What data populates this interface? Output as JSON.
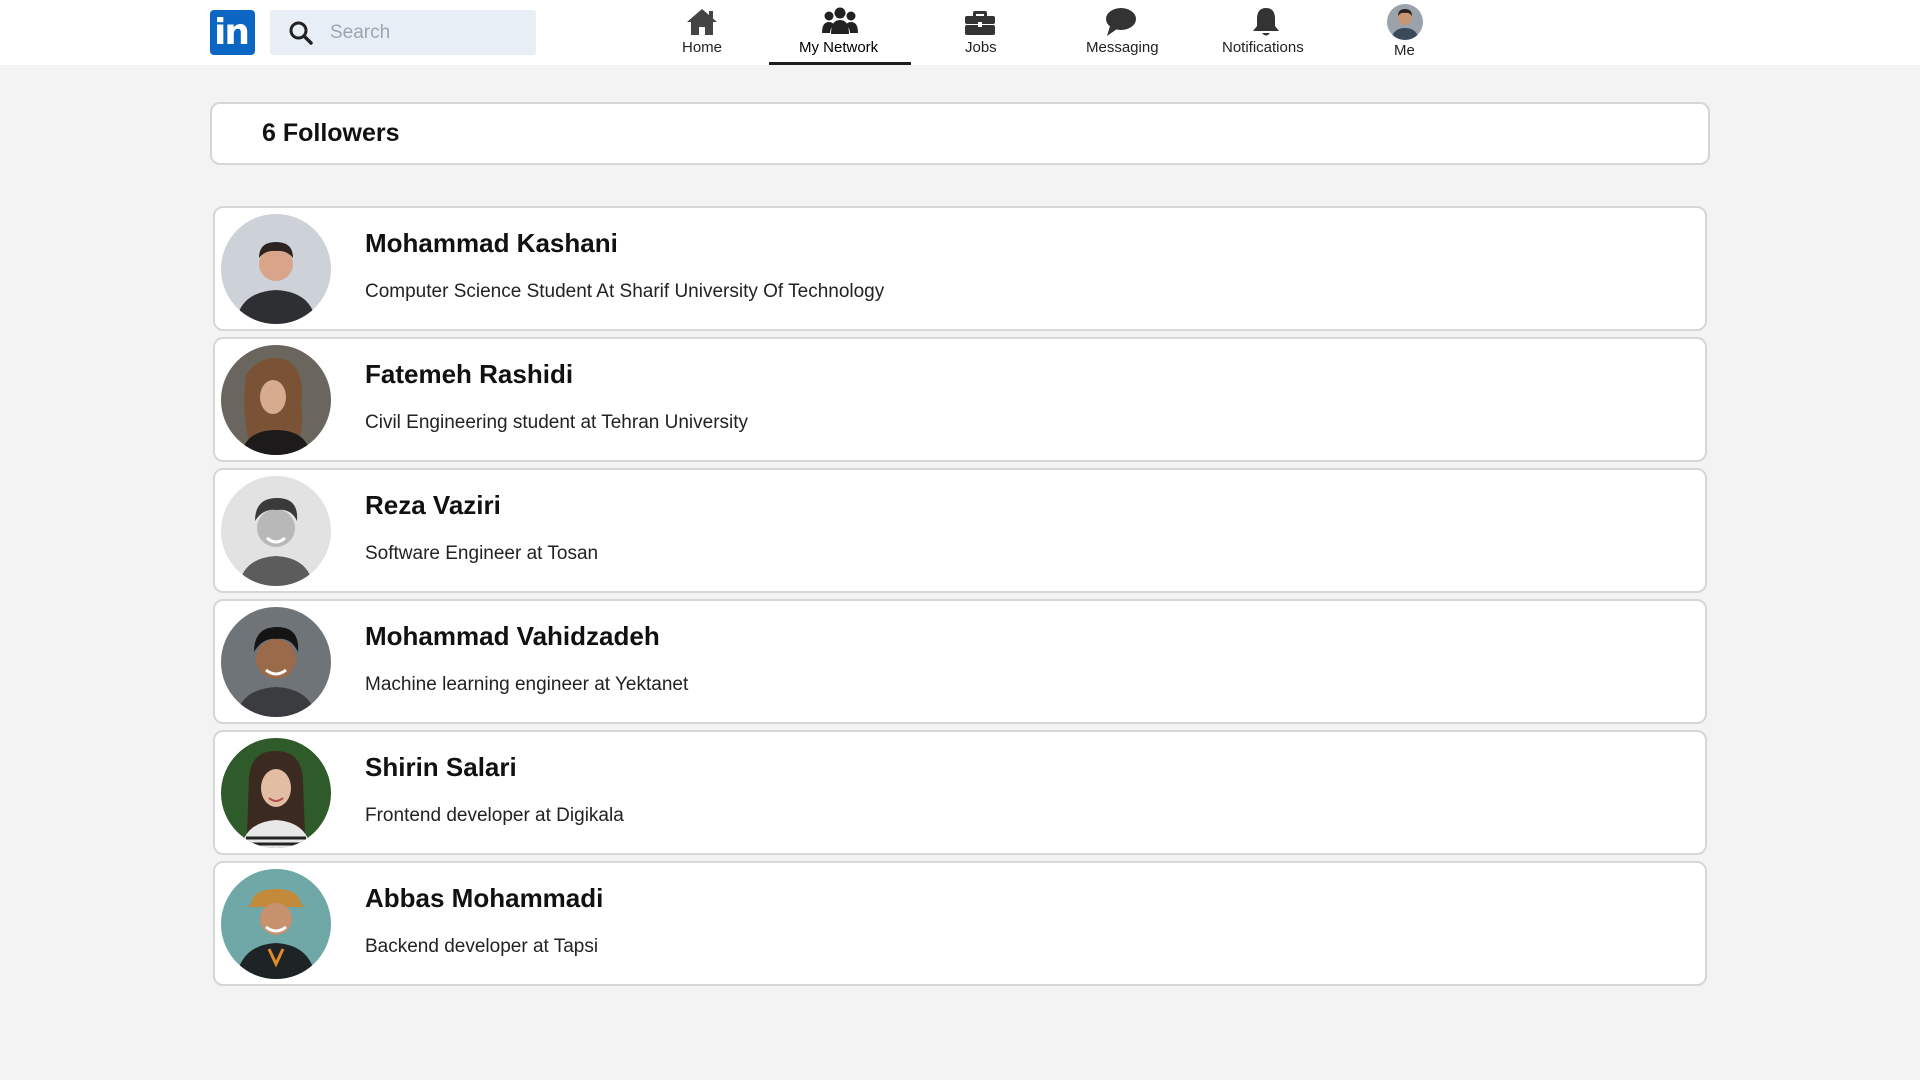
{
  "brand": {
    "logo_text": "in",
    "color": "#0a66c2"
  },
  "search": {
    "placeholder": "Search",
    "value": ""
  },
  "nav": {
    "items": [
      {
        "label": "Home",
        "icon": "home-icon",
        "active": false
      },
      {
        "label": "My Network",
        "icon": "network-icon",
        "active": true
      },
      {
        "label": "Jobs",
        "icon": "briefcase-icon",
        "active": false
      },
      {
        "label": "Messaging",
        "icon": "message-icon",
        "active": false
      },
      {
        "label": "Notifications",
        "icon": "bell-icon",
        "active": false
      },
      {
        "label": "Me",
        "icon": "avatar",
        "active": false
      }
    ]
  },
  "followers": {
    "title": "6 Followers",
    "list": [
      {
        "name": "Mohammad Kashani",
        "headline": "Computer Science Student At Sharif University Of Technology"
      },
      {
        "name": "Fatemeh Rashidi",
        "headline": "Civil Engineering student at Tehran University"
      },
      {
        "name": "Reza Vaziri",
        "headline": "Software Engineer at Tosan"
      },
      {
        "name": "Mohammad Vahidzadeh",
        "headline": "Machine learning engineer at Yektanet"
      },
      {
        "name": "Shirin Salari",
        "headline": "Frontend developer at Digikala"
      },
      {
        "name": "Abbas Mohammadi",
        "headline": "Backend developer at Tapsi"
      }
    ]
  },
  "colors": {
    "page_bg": "#f3f3f3",
    "card_border": "#d6d6d6",
    "search_bg": "#e8eef5",
    "active_underline": "#1d1d1d"
  }
}
